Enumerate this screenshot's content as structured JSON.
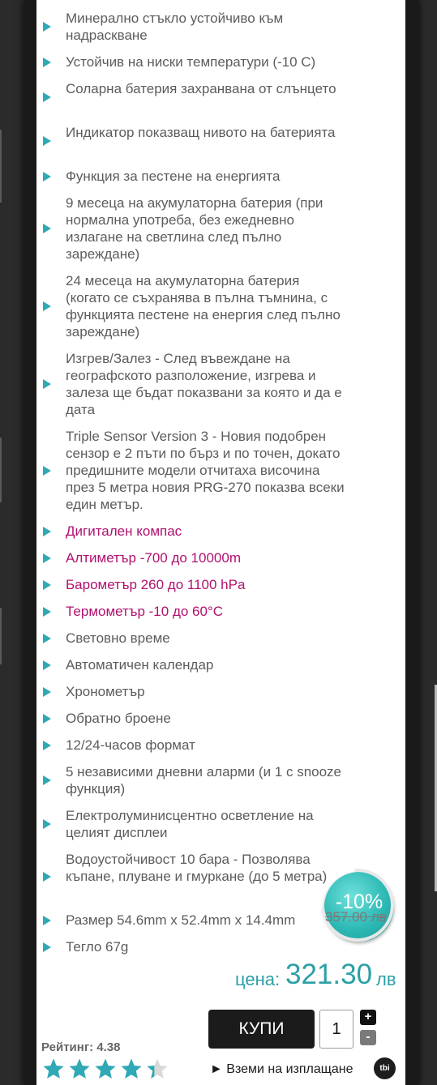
{
  "features": [
    {
      "text": "Минерално стъкло устойчиво към надраскване",
      "highlight": false
    },
    {
      "text": "Устойчив на ниски температури (-10 C)",
      "highlight": false
    },
    {
      "text": "Соларна батерия захранвана от слънцето",
      "highlight": false
    },
    {
      "text": "Индикатор показващ нивото на батерията",
      "highlight": false
    },
    {
      "text": "Функция за пестене на енергията",
      "highlight": false
    },
    {
      "text": "9 месеца на акумулаторна батерия (при нормална употреба, без ежедневно излагане на светлина след пълно зареждане)",
      "highlight": false
    },
    {
      "text": "24 месеца на акумулаторна батерия (когато се съхранява в пълна тъмнина, с функцията пестене на енергия след пълно зареждане)",
      "highlight": false
    },
    {
      "text": "Изгрев/Залез - След въвеждане на географското разположение, изгрева и залеза ще бъдат показвани за която и да е дата",
      "highlight": false
    },
    {
      "text": "Triple Sensor Version 3 - Новия подобрен сензор е 2 пъти по бърз и по точен, докато предишните модели отчитаха височина през 5 метра новия PRG-270 показва всеки един метър.",
      "highlight": false
    },
    {
      "text": "Дигитален компас",
      "highlight": true
    },
    {
      "text": "Алтиметър -700 до 10000m",
      "highlight": true
    },
    {
      "text": "Барометър 260 до 1100 hPa",
      "highlight": true
    },
    {
      "text": "Термометър -10 до 60°C",
      "highlight": true
    },
    {
      "text": "Световно време",
      "highlight": false
    },
    {
      "text": "Автоматичен календар",
      "highlight": false
    },
    {
      "text": "Хронометър",
      "highlight": false
    },
    {
      "text": "Обратно броене",
      "highlight": false
    },
    {
      "text": "12/24-часов формат",
      "highlight": false
    },
    {
      "text": "5 независими дневни аларми (и 1 с snooze функция)",
      "highlight": false
    },
    {
      "text": "Електролуминисцентно осветление на целият дисплеи",
      "highlight": false
    },
    {
      "text": "Водоустойчивост 10 бара - Позволява къпане, плуване и гмуркане (до 5 метра)",
      "highlight": false
    },
    {
      "text": "Размер 54.6mm x 52.4mm x 14.4mm",
      "highlight": false
    },
    {
      "text": "Тегло 67g",
      "highlight": false
    }
  ],
  "discount": {
    "label": "-10%",
    "old_price": "357.00 лв"
  },
  "price": {
    "label": "цена:",
    "value": "321.30",
    "currency": "лв"
  },
  "purchase": {
    "buy_label": "КУПИ",
    "quantity": "1",
    "plus": "+",
    "minus": "-"
  },
  "rating": {
    "label": "Рейтинг: 4.38",
    "value": 4.38,
    "max": 5
  },
  "installment": {
    "label": "► Вземи на изплащане",
    "logo": "tbi"
  },
  "colors": {
    "accent": "#2fa9b5",
    "highlight": "#b0116f",
    "price": "#2a9fa6",
    "button": "#1b1b1b"
  }
}
